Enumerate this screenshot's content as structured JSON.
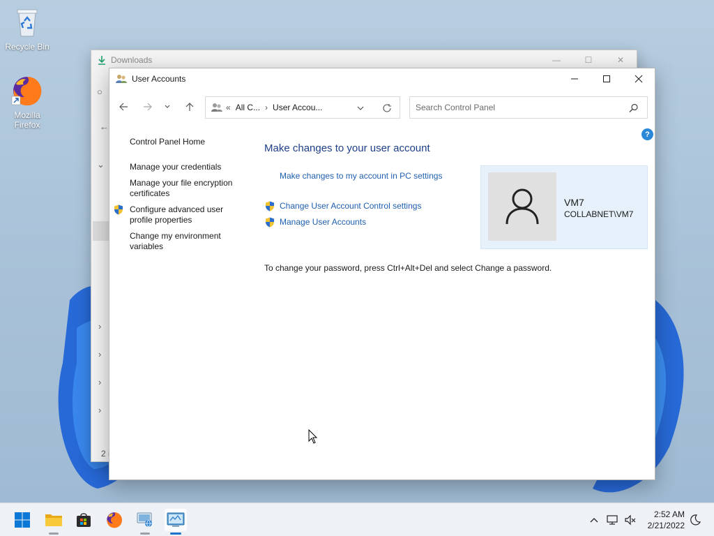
{
  "desktop": {
    "icons": [
      {
        "label": "Recycle Bin",
        "icon": "recycle-bin-icon"
      },
      {
        "label": "Mozilla Firefox",
        "icon": "firefox-icon"
      }
    ]
  },
  "bg_window": {
    "title": "Downloads",
    "status": "2 i"
  },
  "window": {
    "title": "User Accounts",
    "nav": {
      "back": "back-arrow-icon",
      "forward": "forward-arrow-icon",
      "recent": "chevron-down-icon",
      "up": "up-arrow-icon"
    },
    "address": {
      "overflow": "«",
      "crumbs": [
        "All C...",
        "User Accou..."
      ],
      "separator": "›"
    },
    "search": {
      "placeholder": "Search Control Panel"
    },
    "left_nav": [
      {
        "label": "Control Panel Home"
      },
      {
        "label": "Manage your credentials"
      },
      {
        "label": "Manage your file encryption certificates"
      },
      {
        "label": "Configure advanced user profile properties",
        "shield": true
      },
      {
        "label": "Change my environment variables"
      }
    ],
    "main": {
      "heading": "Make changes to your user account",
      "links": [
        {
          "label": "Make changes to my account in PC settings"
        },
        {
          "label": "Change User Account Control settings",
          "shield": true
        },
        {
          "label": "Manage User Accounts",
          "shield": true
        }
      ],
      "info": "To change your password, press Ctrl+Alt+Del and select Change a password."
    },
    "user": {
      "name": "VM7",
      "domain": "COLLABNET\\VM7"
    },
    "help": "?"
  },
  "taskbar": {
    "apps": [
      "start-icon",
      "file-explorer-icon",
      "store-icon",
      "firefox-icon",
      "network-app-icon",
      "control-panel-icon"
    ],
    "time": "2:52 AM",
    "date": "2/21/2022"
  },
  "colors": {
    "link": "#1f5fb0",
    "heading": "#1e3f8a",
    "card_bg": "#e6f1fb",
    "accent": "#1a73c8"
  }
}
